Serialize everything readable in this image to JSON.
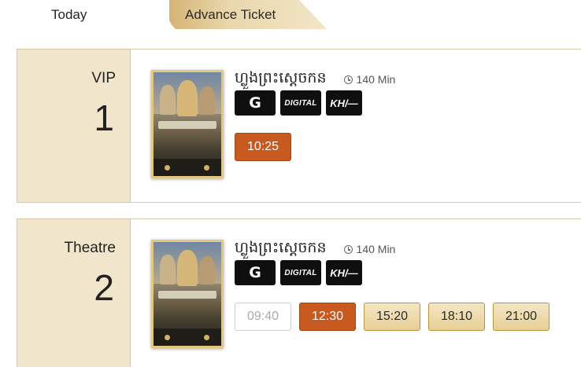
{
  "tabs": [
    {
      "label": "Today"
    },
    {
      "label": "Advance Ticket"
    }
  ],
  "halls": [
    {
      "name": "VIP",
      "number": "1",
      "movie": {
        "title": "ហ្លួងព្រះស្ដេចកន",
        "duration": "140 Min",
        "badges": [
          "G",
          "DIGITAL",
          "KH/—"
        ]
      },
      "showtimes": [
        {
          "time": "10:25",
          "state": "active"
        }
      ]
    },
    {
      "name": "Theatre",
      "number": "2",
      "movie": {
        "title": "ហ្លួងព្រះស្ដេចកន",
        "duration": "140 Min",
        "badges": [
          "G",
          "DIGITAL",
          "KH/—"
        ]
      },
      "showtimes": [
        {
          "time": "09:40",
          "state": "past"
        },
        {
          "time": "12:30",
          "state": "active"
        },
        {
          "time": "15:20",
          "state": "available"
        },
        {
          "time": "18:10",
          "state": "available"
        },
        {
          "time": "21:00",
          "state": "available"
        }
      ]
    }
  ],
  "colors": {
    "accent": "#c8591f",
    "gold": "#e7cf95",
    "hall_bg": "#f1e6cc"
  },
  "icons": {
    "duration": "clock-icon",
    "poster": "movie-poster"
  }
}
